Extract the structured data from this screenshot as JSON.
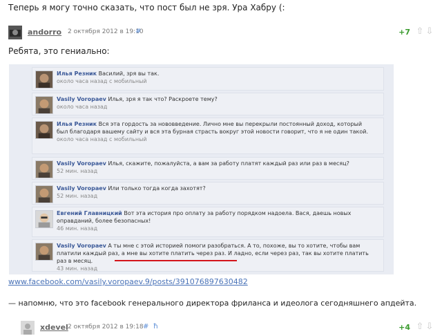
{
  "top_text": "Теперь я могу точно сказать, что пост был не зря. Ура Хабру (:",
  "comment1": {
    "user": "andorro",
    "date": "2 октября 2012 в 19:10",
    "link": "#",
    "score": "+7",
    "body": "Ребята, это гениально:"
  },
  "fb_thread": [
    {
      "name": "Илья Резник",
      "text": "Василий, зря вы так.",
      "time": "около часа назад с мобильный"
    },
    {
      "name": "Vasily Voropaev",
      "text": "Илья, зря я так что? Раскроете тему?",
      "time": "около часа назад"
    },
    {
      "name": "Илья Резник",
      "text": "Вся эта гордость за нововведение. Лично мне вы перекрыли постоянный доход, который был благодаря вашему сайту и вся эта бурная страсть вокруг этой новости говорит, что я не один такой.",
      "time": "около часа назад с мобильный"
    },
    {
      "name": "Vasily Voropaev",
      "text": "Илья, скажите, пожалуйста, а вам за работу платят каждый раз или раз в месяц?",
      "time": "52 мин. назад"
    },
    {
      "name": "Vasily Voropaev",
      "text": "Или только тогда когда захотят?",
      "time": "52 мин. назад"
    },
    {
      "name": "Евгений Главницкий",
      "text": "Вот эта история про оплату за работу порядком надоела. Вася, даешь новых оправданий, более безопасных!",
      "time": "46 мин. назад"
    },
    {
      "name": "Vasily Voropaev",
      "text": "А ты мне с этой историей помоги разобраться. А то, похоже, вы то хотите, чтобы вам платили каждый раз, а мне вы хотите платить через раз. И ладно, если через раз, так вы хотите платить раз в месяц.",
      "time": "43 мин. назад"
    }
  ],
  "fb_link": "www.facebook.com/vasily.voropaev.9/posts/391076897630482",
  "note": "— напомню, что это facebook генерального директора фриланса и идеолога сегодняшнего апдейта.",
  "comment2": {
    "user": "xdevel",
    "date": "2 октября 2012 в 19:18",
    "link": "#",
    "reply_icon": "ħ",
    "score": "+4"
  },
  "colors": {
    "name_blue": "#3b5998",
    "score_green": "#3a9b2e",
    "underline_red": "#d4141a"
  }
}
